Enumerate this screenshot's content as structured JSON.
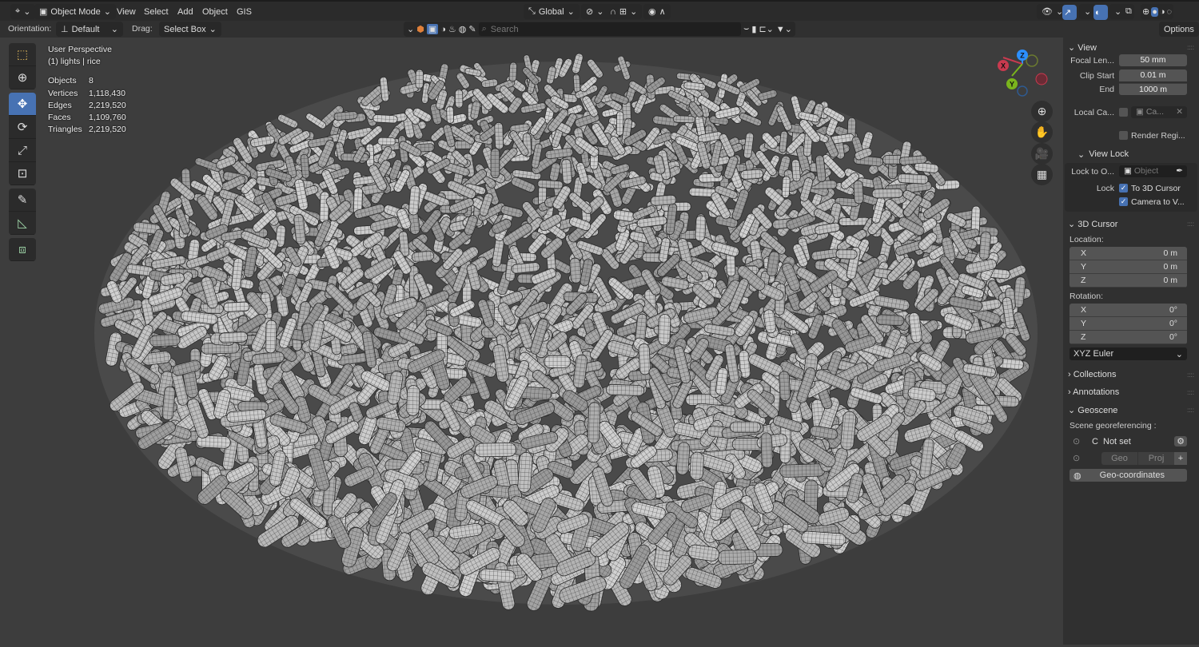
{
  "header": {
    "editor_type_icon": "3d-viewport-icon",
    "mode": "Object Mode",
    "menus": [
      "View",
      "Select",
      "Add",
      "Object",
      "GIS"
    ],
    "transform_orientation": "Global",
    "orientation_label": "Orientation:",
    "orientation_value": "Default",
    "drag_label": "Drag:",
    "drag_value": "Select Box",
    "search_placeholder": "Search",
    "options_label": "Options"
  },
  "overlay": {
    "view_name": "User Perspective",
    "collection": "(1) lights | rice",
    "stats": [
      {
        "label": "Objects",
        "value": "8"
      },
      {
        "label": "Vertices",
        "value": "1,118,430"
      },
      {
        "label": "Edges",
        "value": "2,219,520"
      },
      {
        "label": "Faces",
        "value": "1,109,760"
      },
      {
        "label": "Triangles",
        "value": "2,219,520"
      }
    ]
  },
  "gizmo": {
    "x": "X",
    "y": "Y",
    "z": "Z",
    "colors": {
      "x": "#c93a4f",
      "y": "#7ab51d",
      "z": "#2c8fff"
    }
  },
  "panel": {
    "view": {
      "title": "View",
      "focal_label": "Focal Len...",
      "focal": "50 mm",
      "clip_start_label": "Clip Start",
      "clip_start": "0.01 m",
      "end_label": "End",
      "end": "1000 m",
      "local_cam_label": "Local Ca...",
      "local_cam_value": "Ca...",
      "render_region": "Render Regi..."
    },
    "view_lock": {
      "title": "View Lock",
      "lock_to_label": "Lock to O...",
      "lock_to_placeholder": "Object",
      "lock_label": "Lock",
      "to_cursor": "To 3D Cursor",
      "camera_to_view": "Camera to V..."
    },
    "cursor": {
      "title": "3D Cursor",
      "location_label": "Location:",
      "location": [
        {
          "axis": "X",
          "value": "0 m"
        },
        {
          "axis": "Y",
          "value": "0 m"
        },
        {
          "axis": "Z",
          "value": "0 m"
        }
      ],
      "rotation_label": "Rotation:",
      "rotation": [
        {
          "axis": "X",
          "value": "0°"
        },
        {
          "axis": "Y",
          "value": "0°"
        },
        {
          "axis": "Z",
          "value": "0°"
        }
      ],
      "rotation_mode": "XYZ Euler"
    },
    "collections": "Collections",
    "annotations": "Annotations",
    "geoscene": {
      "title": "Geoscene",
      "georef_label": "Scene georeferencing :",
      "crs_letter": "C",
      "crs_value": "Not set",
      "geo": "Geo",
      "proj": "Proj",
      "geo_coords": "Geo-coordinates"
    }
  },
  "accent": "#4772b3"
}
